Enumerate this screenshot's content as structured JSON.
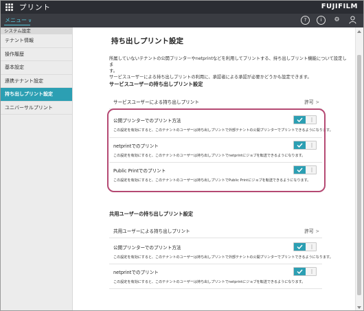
{
  "header": {
    "app_title": "プリント",
    "brand": "FUJIFILM",
    "menu_label": "メニュー",
    "icons": [
      "help-icon",
      "info-icon",
      "settings-icon",
      "user-icon"
    ]
  },
  "sidebar": {
    "section_header": "システム設定",
    "items": [
      {
        "label": "テナント情報",
        "active": false
      },
      {
        "label": "操作履歴",
        "active": false
      },
      {
        "label": "基本設定",
        "active": false
      },
      {
        "label": "連携テナント設定",
        "active": false
      },
      {
        "label": "持ち出しプリント設定",
        "active": true
      },
      {
        "label": "ユニバーサルプリント",
        "active": false
      }
    ]
  },
  "main": {
    "page_title": "持ち出しプリント設定",
    "description_line1": "所属していないテナントの公開プリンターやnetprintなどを利用してプリントする、持ち出しプリント機能について設定しま",
    "description_line2": "す。",
    "description_line3": "サービスユーザーによる持ち出しプリントの利用に、承認者による承認が必要かどうかも設定できます。",
    "service_section": {
      "title": "サービスユーザーの持ち出しプリント設定",
      "permission_row": {
        "label": "サービスユーザーによる持ち出しプリント",
        "value": "許可"
      },
      "settings": [
        {
          "label": "公開プリンターでのプリント方法",
          "desc": "この設定を有効にすると、このテナントのユーザーは持ち出しプリントで外部テナントの公開プリンターでプリントできるようになります。",
          "enabled": true
        },
        {
          "label": "netprintでのプリント",
          "desc": "この設定を有効にすると、このテナントのユーザーは持ち出しプリントでnetprintにジョブを転送できるようになります。",
          "enabled": true
        },
        {
          "label": "Public Printでのプリント",
          "desc": "この設定を有効にすると、このテナントのユーザーは持ち出しプリントでPublic Printにジョブを転送できるようになります。",
          "enabled": true
        }
      ]
    },
    "shared_section": {
      "title": "共用ユーザーの持ち出しプリント設定",
      "permission_row": {
        "label": "共用ユーザーによる持ち出しプリント",
        "value": "許可"
      },
      "settings": [
        {
          "label": "公開プリンターでのプリント方法",
          "desc": "この設定を有効にすると、このテナントのユーザーは持ち出しプリントで外部テナントの公開プリンターでプリントできるようになります。",
          "enabled": true
        },
        {
          "label": "netprintでのプリント",
          "desc": "この設定を有効にすると、このテナントのユーザーは持ち出しプリントでnetprintにジョブを転送できるようになります。",
          "enabled": true
        }
      ]
    }
  },
  "colors": {
    "accent": "#2c9fb3",
    "highlight": "#b44872",
    "topbar": "#2b2d33"
  }
}
